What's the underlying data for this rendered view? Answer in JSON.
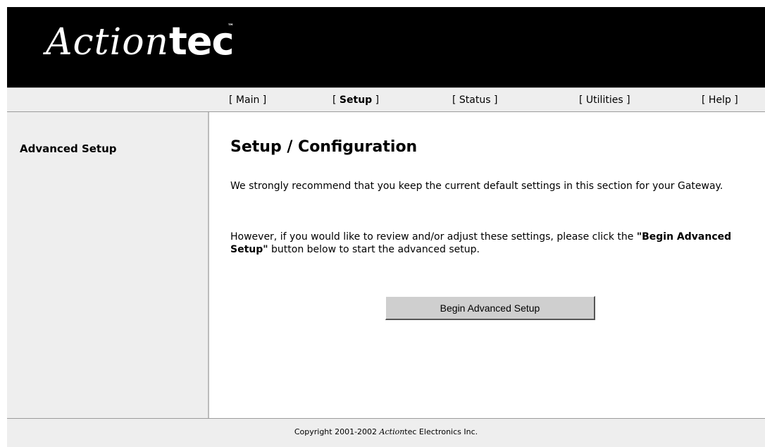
{
  "logo": {
    "script_part": "Action",
    "block_part": "tec",
    "trademark": "™"
  },
  "nav": {
    "items": [
      {
        "label": "Main",
        "active": false
      },
      {
        "label": "Setup",
        "active": true
      },
      {
        "label": "Status",
        "active": false
      },
      {
        "label": "Utilities",
        "active": false
      },
      {
        "label": "Help",
        "active": false
      }
    ],
    "bracket_open": "[ ",
    "bracket_close": " ]"
  },
  "sidebar": {
    "title": "Advanced Setup"
  },
  "main": {
    "title": "Setup / Configuration",
    "paragraph1": "We strongly recommend that you keep the current default settings in this section for your Gateway.",
    "paragraph2_before": "However, if you would like to review and/or adjust these settings, please click the ",
    "paragraph2_bold": "\"Begin Advanced Setup\"",
    "paragraph2_after": " button below to start the advanced setup.",
    "button_label": "Begin Advanced Setup"
  },
  "footer": {
    "prefix": "Copyright 2001-2002 ",
    "brand_italic": "Action",
    "brand_rest": "tec",
    "suffix": " Electronics Inc."
  },
  "colors": {
    "header_bg": "#000000",
    "panel_bg": "#eeeeee",
    "button_bg": "#cfcfcf"
  }
}
